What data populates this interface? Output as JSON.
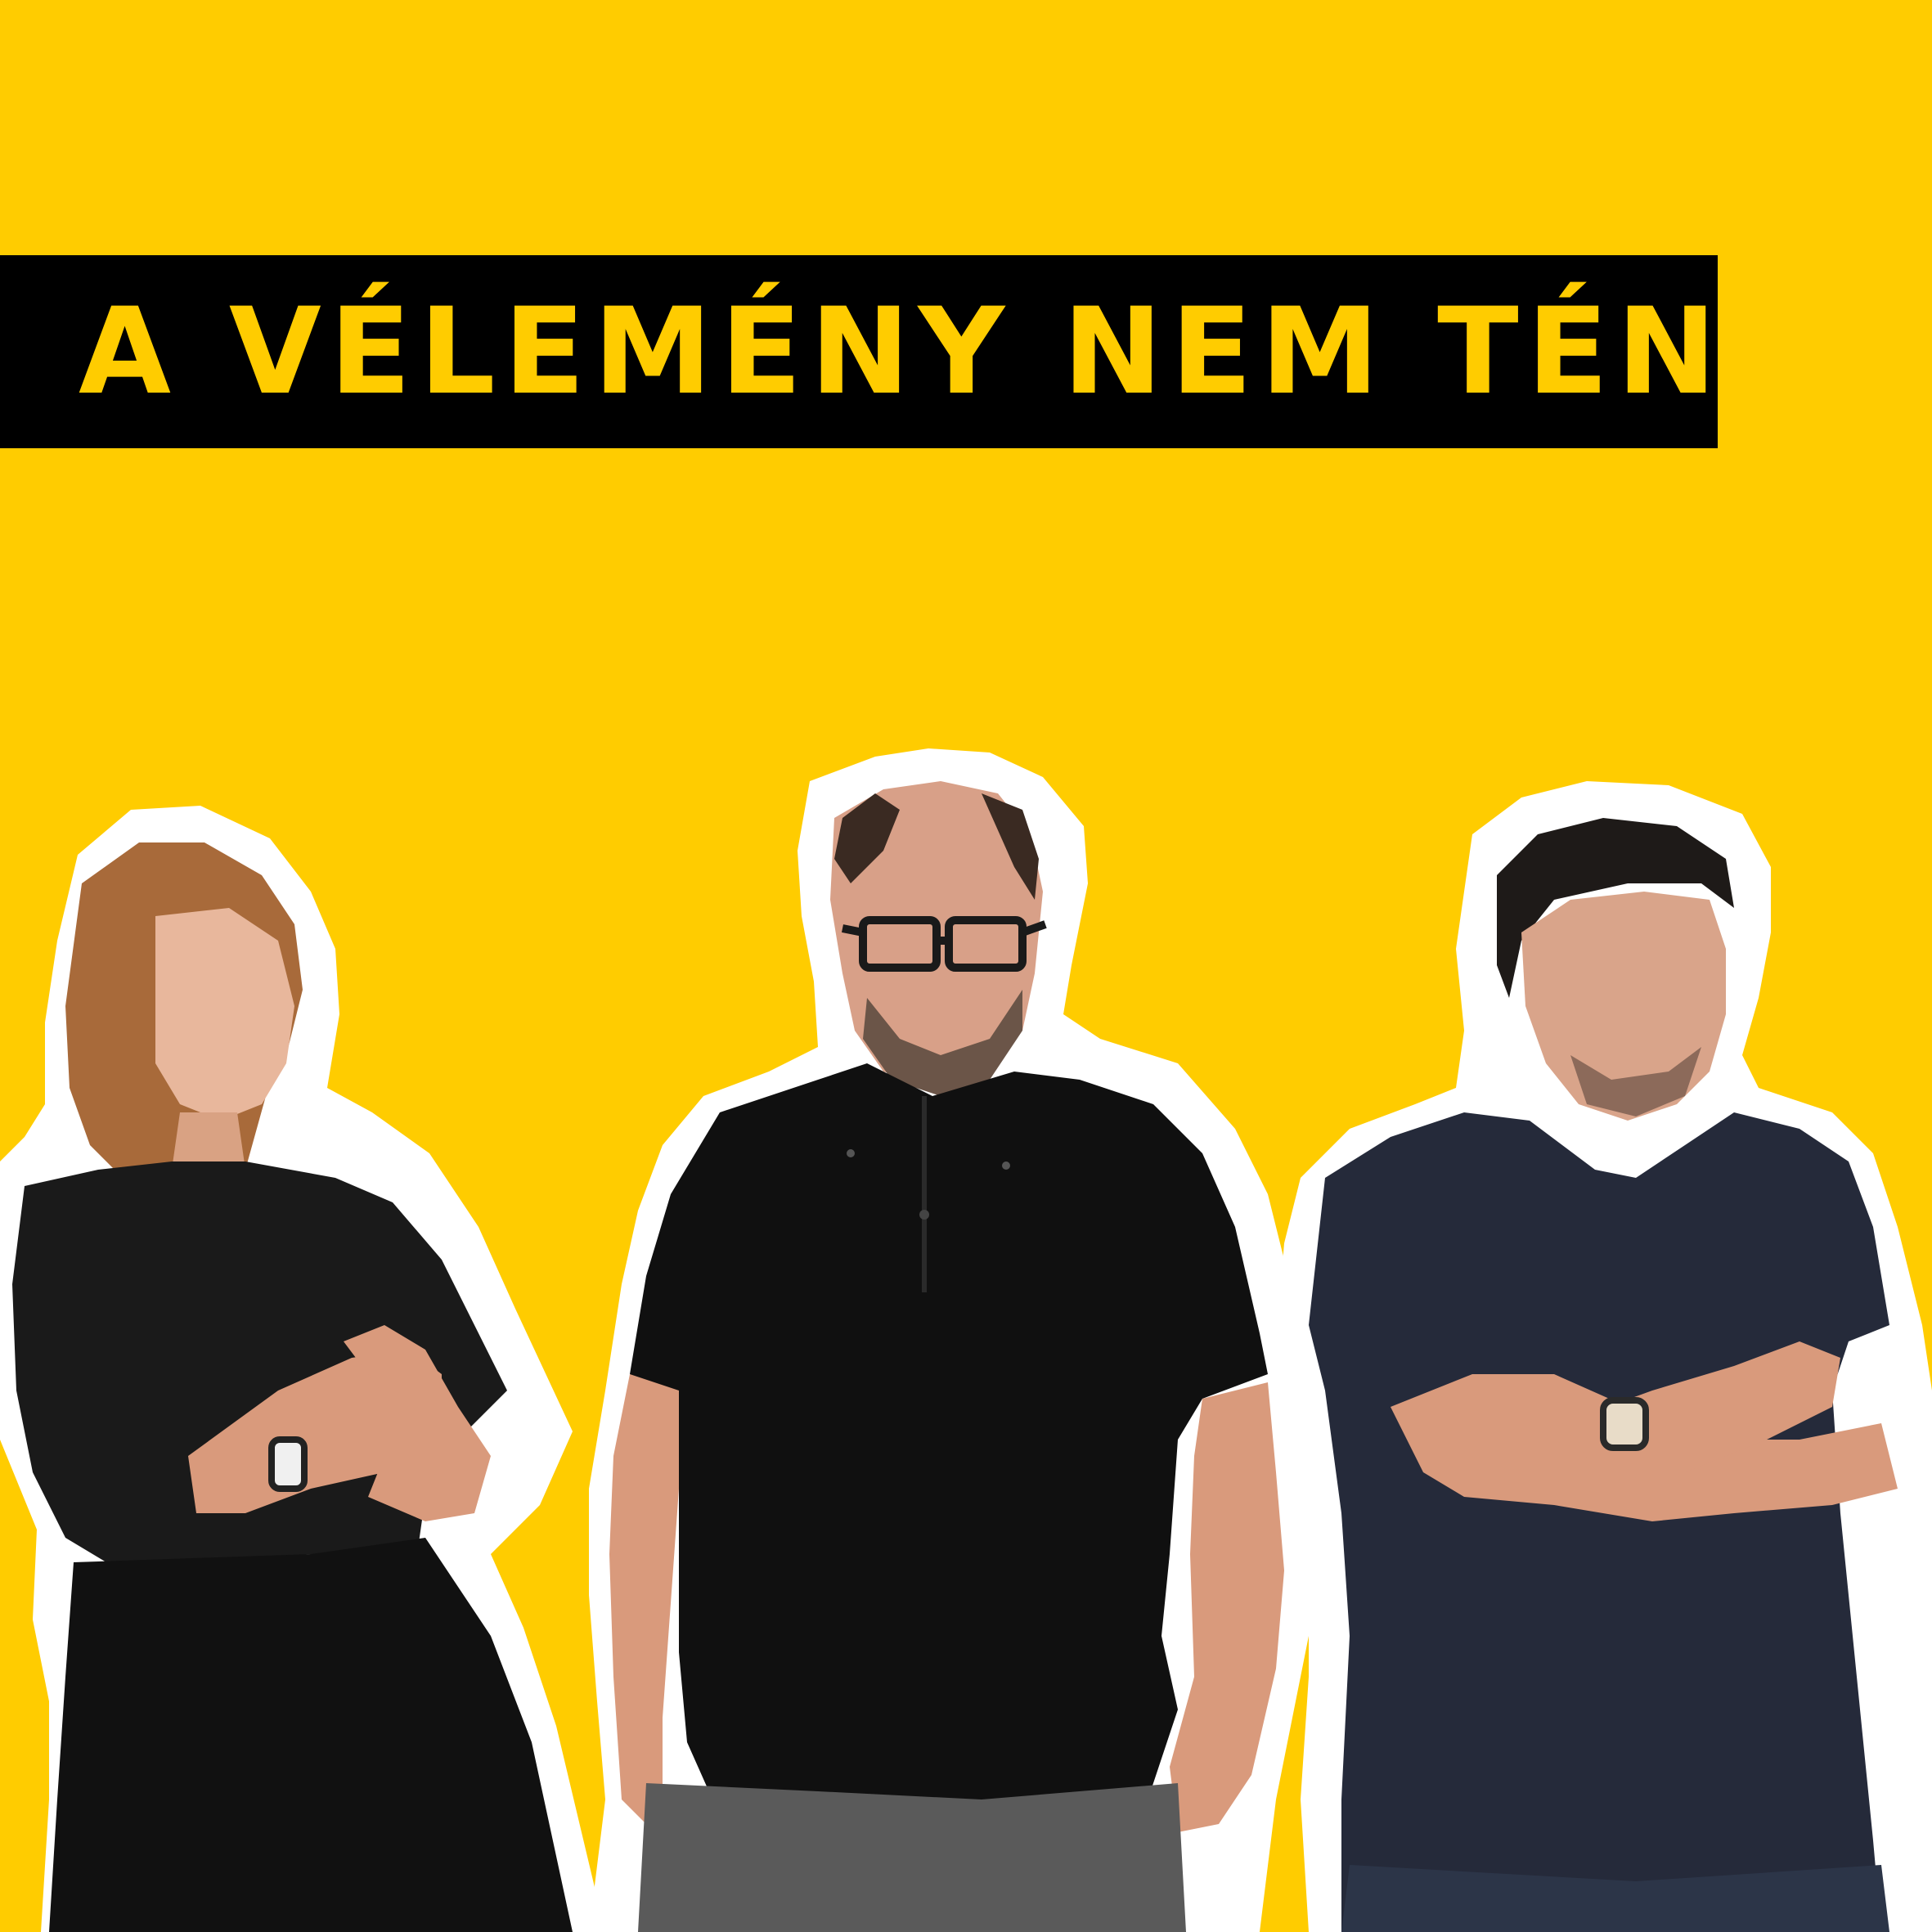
{
  "header": {
    "title": "A VÉLEMÉNY NEM TÉNY"
  },
  "colors": {
    "background": "#FFCC00",
    "banner": "#000000",
    "title_text": "#FFCC00",
    "cutout_outline": "#FFFFFF"
  },
  "people": [
    {
      "name": "person-left",
      "description_visible": false
    },
    {
      "name": "person-center",
      "description_visible": false
    },
    {
      "name": "person-right",
      "description_visible": false
    }
  ]
}
